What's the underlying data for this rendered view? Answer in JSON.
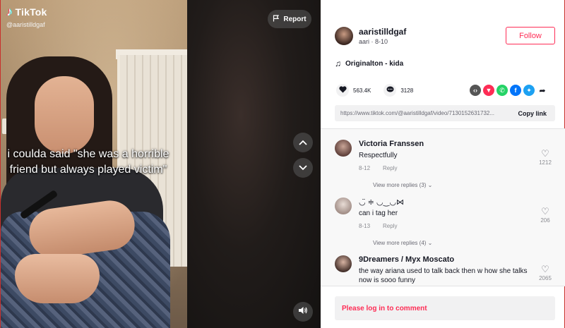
{
  "brand": {
    "name": "TikTok",
    "handle": "@aaristilldgaf"
  },
  "video": {
    "caption": "i coulda said \"she was a horrible friend but always played victim\"",
    "report_label": "Report"
  },
  "author": {
    "username": "aaristilldgaf",
    "nickname": "aari",
    "date": "8-10",
    "follow_label": "Follow"
  },
  "music": {
    "title": "Originalton - kida"
  },
  "stats": {
    "likes": "563.4K",
    "comments": "3128"
  },
  "share": {
    "icons": [
      "embed-icon",
      "send-icon",
      "whatsapp-icon",
      "facebook-icon",
      "twitter-icon",
      "forward-icon"
    ],
    "colors": {
      "embed": "#555555",
      "send": "#fe2c55",
      "whatsapp": "#25d366",
      "facebook": "#0075fa",
      "twitter": "#1da1f2"
    }
  },
  "link": {
    "url": "https://www.tiktok.com/@aaristilldgaf/video/7130152631732...",
    "copy_label": "Copy link"
  },
  "comments": [
    {
      "name": "Victoria Franssen",
      "text": "Respectfully",
      "date": "8-12",
      "reply": "Reply",
      "likes": "1212",
      "more": "View more replies (3)"
    },
    {
      "name": "◡̈ ≑ ◡‿◡⋈",
      "text": "can i tag her",
      "date": "8-13",
      "reply": "Reply",
      "likes": "206",
      "more": "View more replies (4)"
    },
    {
      "name": "9Dreamers / Myx Moscato",
      "text": "the way ariana used to talk back then w how she talks now is sooo funny",
      "likes": "2065"
    }
  ],
  "login_prompt": "Please log in to comment",
  "accent": "#fe2c55"
}
